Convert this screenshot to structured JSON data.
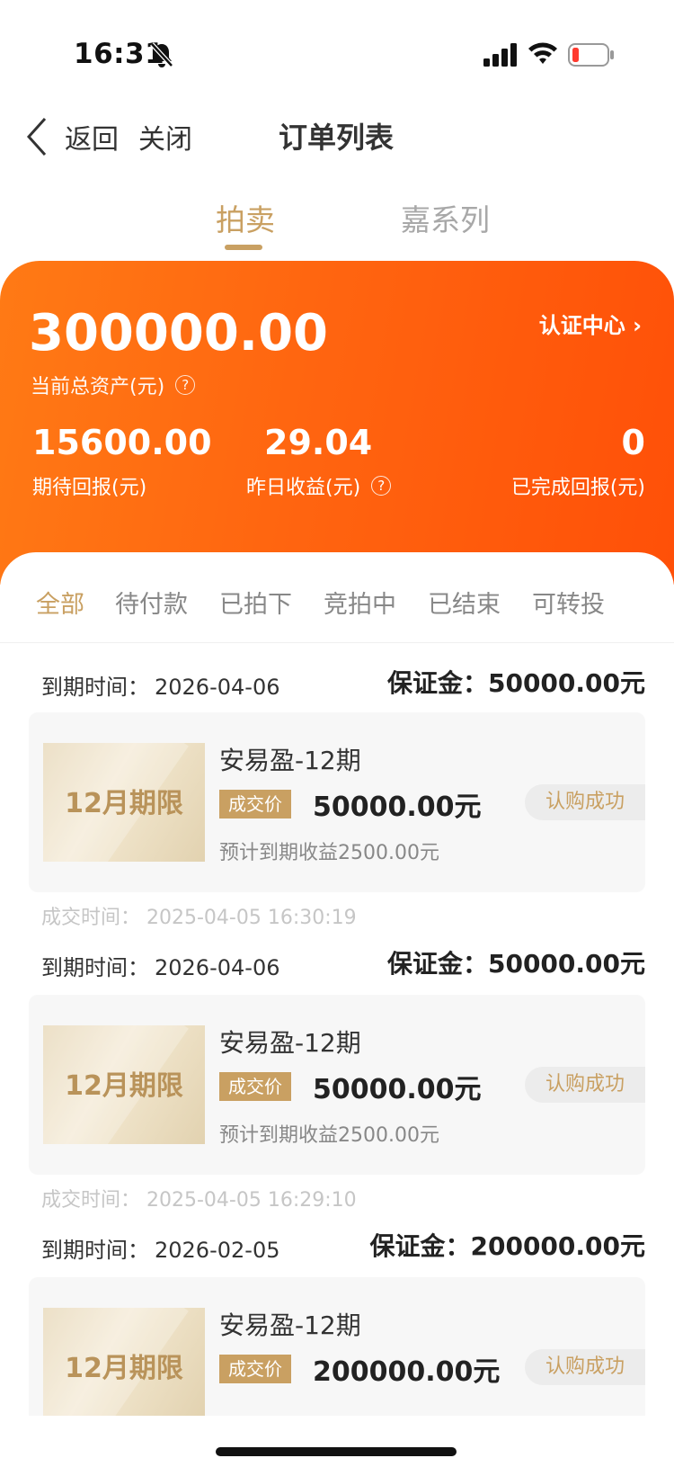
{
  "status_bar": {
    "time": "16:31"
  },
  "nav": {
    "back": "返回",
    "close": "关闭",
    "title": "订单列表"
  },
  "tabs": [
    "拍卖",
    "嘉系列"
  ],
  "summary": {
    "total_assets": "300000.00",
    "total_assets_label": "当前总资产(元)",
    "cert_center": "认证中心 ›",
    "expected_return": "15600.00",
    "expected_return_label": "期待回报(元)",
    "yesterday_income": "29.04",
    "yesterday_income_label": "昨日收益(元)",
    "completed_return": "0",
    "completed_return_label": "已完成回报(元)"
  },
  "filter_tabs": [
    "全部",
    "待付款",
    "已拍下",
    "竞拍中",
    "已结束",
    "可转投"
  ],
  "orders": [
    {
      "due_label": "到期时间：",
      "due_date": "2026-04-06",
      "deposit_label": "保证金：",
      "deposit": "50000.00元",
      "thumb_text": "12月期限",
      "product": "安易盈-12期",
      "price_tag": "成交价",
      "price": "50000.00元",
      "expected": "预计到期收益2500.00元",
      "status": "认购成功",
      "deal_time": "成交时间：  2025-04-05 16:30:19"
    },
    {
      "due_label": "到期时间：",
      "due_date": "2026-04-06",
      "deposit_label": "保证金：",
      "deposit": "50000.00元",
      "thumb_text": "12月期限",
      "product": "安易盈-12期",
      "price_tag": "成交价",
      "price": "50000.00元",
      "expected": "预计到期收益2500.00元",
      "status": "认购成功",
      "deal_time": "成交时间：  2025-04-05 16:29:10"
    },
    {
      "due_label": "到期时间：",
      "due_date": "2026-02-05",
      "deposit_label": "保证金：",
      "deposit": "200000.00元",
      "thumb_text": "12月期限",
      "product": "安易盈-12期",
      "price_tag": "成交价",
      "price": "200000.00元",
      "status": "认购成功"
    }
  ],
  "colors": {
    "accent_gold": "#c9a062",
    "hero_orange": "#ff6510"
  }
}
